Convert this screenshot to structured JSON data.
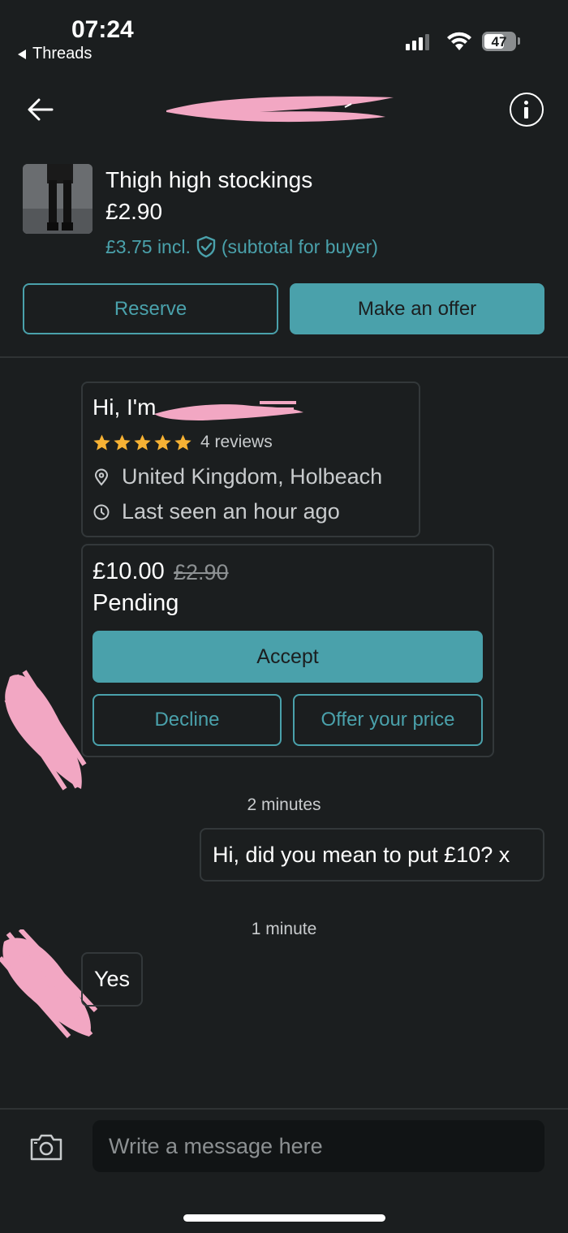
{
  "status_bar": {
    "time": "07:24",
    "back_app": "Threads",
    "battery": "47"
  },
  "item": {
    "title": "Thigh high stockings",
    "price": "£2.90",
    "price_incl": "£3.75 incl.",
    "buyer_note": "(subtotal for buyer)"
  },
  "actions": {
    "reserve": "Reserve",
    "make_offer": "Make an offer"
  },
  "profile": {
    "greeting": "Hi, I'm",
    "rating_stars": 5,
    "reviews": "4 reviews",
    "location": "United Kingdom, Holbeach",
    "last_seen": "Last seen an hour ago"
  },
  "offer": {
    "new_price": "£10.00",
    "old_price": "£2.90",
    "status": "Pending",
    "accept": "Accept",
    "decline": "Decline",
    "offer_your_price": "Offer your price"
  },
  "messages": [
    {
      "timestamp": "2 minutes",
      "text": "Hi, did you mean to put £10? x",
      "direction": "outgoing"
    },
    {
      "timestamp": "1 minute",
      "text": "Yes",
      "direction": "incoming"
    }
  ],
  "composer": {
    "placeholder": "Write a message here"
  },
  "colors": {
    "background": "#1b1e1f",
    "accent": "#4aa1ab",
    "star": "#f7b234",
    "redaction": "#f2a7c3"
  },
  "icons": [
    "back-arrow-icon",
    "info-icon",
    "shield-check-icon",
    "star-icon",
    "location-pin-icon",
    "clock-icon",
    "camera-icon",
    "wifi-icon",
    "signal-icon",
    "battery-icon"
  ]
}
